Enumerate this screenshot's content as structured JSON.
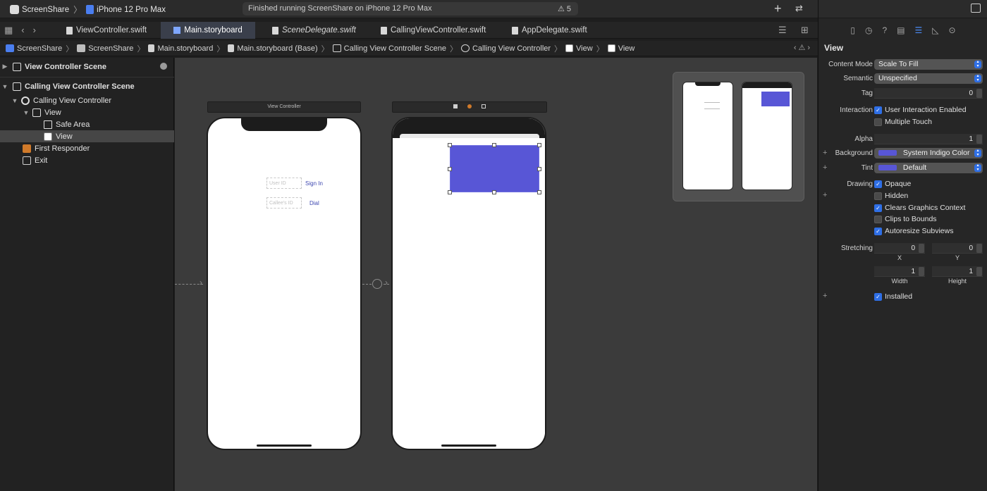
{
  "titlebar": {
    "scheme": "ScreenShare",
    "device": "iPhone 12 Pro Max",
    "status": "Finished running ScreenShare on iPhone 12 Pro Max",
    "warnings": "5"
  },
  "tabs": [
    {
      "label": "ViewController.swift"
    },
    {
      "label": "Main.storyboard"
    },
    {
      "label": "SceneDelegate.swift"
    },
    {
      "label": "CallingViewController.swift"
    },
    {
      "label": "AppDelegate.swift"
    }
  ],
  "breadcrumb": [
    "ScreenShare",
    "ScreenShare",
    "Main.storyboard",
    "Main.storyboard (Base)",
    "Calling View Controller Scene",
    "Calling View Controller",
    "View",
    "View"
  ],
  "outline": {
    "items": [
      {
        "label": "View Controller Scene"
      },
      {
        "label": "Calling View Controller Scene"
      },
      {
        "label": "Calling View Controller"
      },
      {
        "label": "View"
      },
      {
        "label": "Safe Area"
      },
      {
        "label": "View"
      },
      {
        "label": "First Responder"
      },
      {
        "label": "Exit"
      }
    ]
  },
  "canvas": {
    "scene1_title": "View Controller",
    "user_id_placeholder": "User ID",
    "sign_in": "Sign In",
    "callee_id_placeholder": "Callee's ID",
    "dial": "Dial"
  },
  "inspector": {
    "heading": "View",
    "content_mode_label": "Content Mode",
    "content_mode": "Scale To Fill",
    "semantic_label": "Semantic",
    "semantic": "Unspecified",
    "tag_label": "Tag",
    "tag": "0",
    "interaction_label": "Interaction",
    "user_interaction": "User Interaction Enabled",
    "multiple_touch": "Multiple Touch",
    "alpha_label": "Alpha",
    "alpha": "1",
    "background_label": "Background",
    "background": "System Indigo Color",
    "tint_label": "Tint",
    "tint": "Default",
    "drawing_label": "Drawing",
    "opaque": "Opaque",
    "hidden": "Hidden",
    "clears_context": "Clears Graphics Context",
    "clips_bounds": "Clips to Bounds",
    "autoresize": "Autoresize Subviews",
    "stretching_label": "Stretching",
    "stretch_x": "0",
    "stretch_y": "0",
    "x_label": "X",
    "y_label": "Y",
    "stretch_w": "1",
    "stretch_h": "1",
    "width_label": "Width",
    "height_label": "Height",
    "installed": "Installed"
  },
  "colors": {
    "indigo": "#5856d6",
    "accent": "#2f6fe6"
  }
}
